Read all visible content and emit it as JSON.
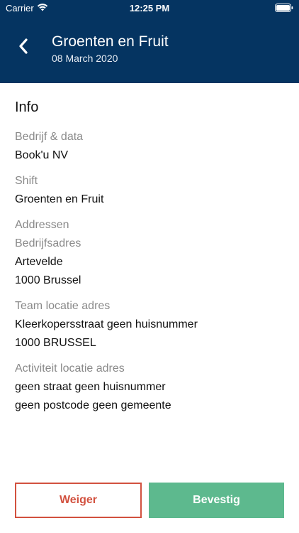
{
  "status_bar": {
    "carrier": "Carrier",
    "time": "12:25 PM"
  },
  "header": {
    "title": "Groenten en Fruit",
    "date": "08 March 2020",
    "background": "#053461"
  },
  "info": {
    "section_title": "Info",
    "company_label": "Bedrijf & data",
    "company_value": "Book'u NV",
    "shift_label": "Shift",
    "shift_value": "Groenten en Fruit",
    "addresses_label": "Addressen",
    "company_address_label": "Bedrijfsadres",
    "company_address_line1": "Artevelde",
    "company_address_line2": "1000 Brussel",
    "team_location_label": "Team locatie adres",
    "team_location_line1": "Kleerkopersstraat geen huisnummer",
    "team_location_line2": "1000 BRUSSEL",
    "activity_location_label": "Activiteit locatie adres",
    "activity_location_line1": "geen straat geen huisnummer",
    "activity_location_line2": "geen postcode geen gemeente"
  },
  "actions": {
    "decline_label": "Weiger",
    "confirm_label": "Bevestig",
    "decline_color": "#d2513f",
    "confirm_color": "#5db98e"
  },
  "icons": {
    "back": "chevron-left-icon",
    "wifi": "wifi-icon",
    "battery": "battery-icon"
  }
}
